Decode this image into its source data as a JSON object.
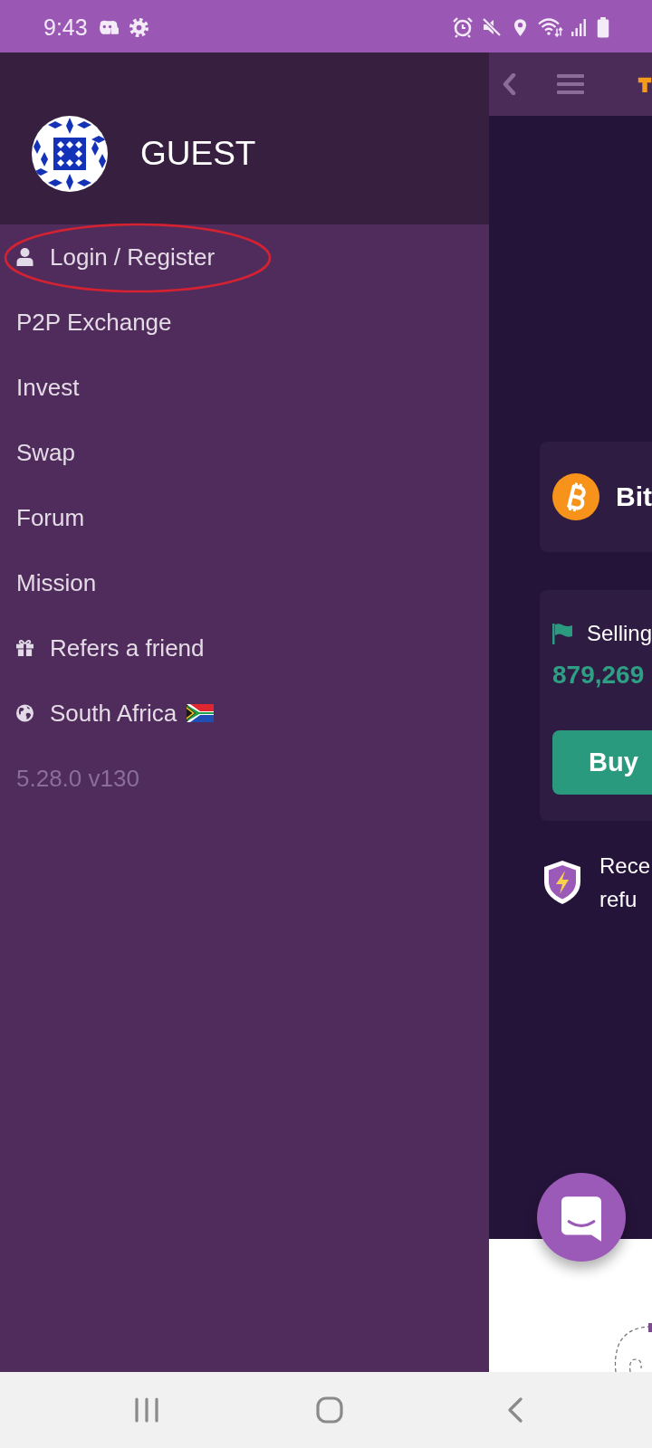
{
  "status_bar": {
    "time": "9:43"
  },
  "drawer": {
    "user_name": "GUEST",
    "items": [
      {
        "kind": "account",
        "label": "Login / Register",
        "circled": true
      },
      {
        "kind": "plain",
        "label": "P2P Exchange",
        "circled": false
      },
      {
        "kind": "plain",
        "label": "Invest",
        "circled": false
      },
      {
        "kind": "plain",
        "label": "Swap",
        "circled": false
      },
      {
        "kind": "plain",
        "label": "Forum",
        "circled": false
      },
      {
        "kind": "plain",
        "label": "Mission",
        "circled": false
      },
      {
        "kind": "gift",
        "label": "Refers a friend",
        "circled": false
      },
      {
        "kind": "country",
        "label": "South Africa",
        "circled": false
      }
    ],
    "version": "5.28.0 v130"
  },
  "page": {
    "coin_card": {
      "name": "Bit"
    },
    "offer_card": {
      "label": "Selling",
      "price": "879,269",
      "button": "Buy"
    },
    "notice": {
      "lines": [
        "Rece",
        "refu"
      ]
    }
  }
}
